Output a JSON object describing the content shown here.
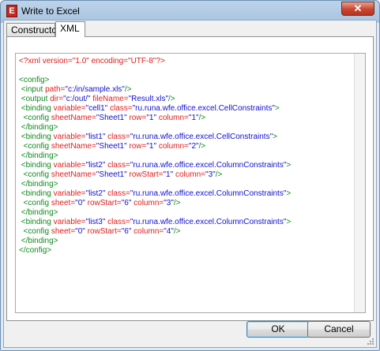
{
  "window": {
    "title": "Write to Excel",
    "icon_glyph": "E",
    "close_glyph": "✕"
  },
  "tabs": [
    {
      "label": "Constructor",
      "active": false
    },
    {
      "label": "XML",
      "active": true
    }
  ],
  "editor": {
    "lines": [
      [
        {
          "t": "decl",
          "s": "<?xml version=\"1.0\" encoding=\"UTF-8\"?>"
        }
      ],
      [],
      [
        {
          "t": "tag",
          "s": "<config>"
        }
      ],
      [
        {
          "t": "tag",
          "s": " <input "
        },
        {
          "t": "attr",
          "s": "path="
        },
        {
          "t": "val",
          "s": "\"c:/in/sample.xls\""
        },
        {
          "t": "tag",
          "s": "/>"
        }
      ],
      [
        {
          "t": "tag",
          "s": " <output "
        },
        {
          "t": "attr",
          "s": "dir="
        },
        {
          "t": "val",
          "s": "\"c:/out/\""
        },
        {
          "t": "attr",
          "s": " fileName="
        },
        {
          "t": "val",
          "s": "\"Result.xls\""
        },
        {
          "t": "tag",
          "s": "/>"
        }
      ],
      [
        {
          "t": "tag",
          "s": " <binding "
        },
        {
          "t": "attr",
          "s": "variable="
        },
        {
          "t": "val",
          "s": "\"cell1\""
        },
        {
          "t": "attr",
          "s": " class="
        },
        {
          "t": "val",
          "s": "\"ru.runa.wfe.office.excel.CellConstraints\""
        },
        {
          "t": "tag",
          "s": ">"
        }
      ],
      [
        {
          "t": "tag",
          "s": "  <config "
        },
        {
          "t": "attr",
          "s": "sheetName="
        },
        {
          "t": "val",
          "s": "\"Sheet1\""
        },
        {
          "t": "attr",
          "s": " row="
        },
        {
          "t": "val",
          "s": "\"1\""
        },
        {
          "t": "attr",
          "s": " column="
        },
        {
          "t": "val",
          "s": "\"1\""
        },
        {
          "t": "tag",
          "s": "/>"
        }
      ],
      [
        {
          "t": "tag",
          "s": " </binding>"
        }
      ],
      [
        {
          "t": "tag",
          "s": " <binding "
        },
        {
          "t": "attr",
          "s": "variable="
        },
        {
          "t": "val",
          "s": "\"list1\""
        },
        {
          "t": "attr",
          "s": " class="
        },
        {
          "t": "val",
          "s": "\"ru.runa.wfe.office.excel.CellConstraints\""
        },
        {
          "t": "tag",
          "s": ">"
        }
      ],
      [
        {
          "t": "tag",
          "s": "  <config "
        },
        {
          "t": "attr",
          "s": "sheetName="
        },
        {
          "t": "val",
          "s": "\"Sheet1\""
        },
        {
          "t": "attr",
          "s": " row="
        },
        {
          "t": "val",
          "s": "\"1\""
        },
        {
          "t": "attr",
          "s": " column="
        },
        {
          "t": "val",
          "s": "\"2\""
        },
        {
          "t": "tag",
          "s": "/>"
        }
      ],
      [
        {
          "t": "tag",
          "s": " </binding>"
        }
      ],
      [
        {
          "t": "tag",
          "s": " <binding "
        },
        {
          "t": "attr",
          "s": "variable="
        },
        {
          "t": "val",
          "s": "\"list2\""
        },
        {
          "t": "attr",
          "s": " class="
        },
        {
          "t": "val",
          "s": "\"ru.runa.wfe.office.excel.ColumnConstraints\""
        },
        {
          "t": "tag",
          "s": ">"
        }
      ],
      [
        {
          "t": "tag",
          "s": "  <config "
        },
        {
          "t": "attr",
          "s": "sheetName="
        },
        {
          "t": "val",
          "s": "\"Sheet1\""
        },
        {
          "t": "attr",
          "s": " rowStart="
        },
        {
          "t": "val",
          "s": "\"1\""
        },
        {
          "t": "attr",
          "s": " column="
        },
        {
          "t": "val",
          "s": "\"3\""
        },
        {
          "t": "tag",
          "s": "/>"
        }
      ],
      [
        {
          "t": "tag",
          "s": " </binding>"
        }
      ],
      [
        {
          "t": "tag",
          "s": " <binding "
        },
        {
          "t": "attr",
          "s": "variable="
        },
        {
          "t": "val",
          "s": "\"list2\""
        },
        {
          "t": "attr",
          "s": " class="
        },
        {
          "t": "val",
          "s": "\"ru.runa.wfe.office.excel.ColumnConstraints\""
        },
        {
          "t": "tag",
          "s": ">"
        }
      ],
      [
        {
          "t": "tag",
          "s": "  <config "
        },
        {
          "t": "attr",
          "s": "sheet="
        },
        {
          "t": "val",
          "s": "\"0\""
        },
        {
          "t": "attr",
          "s": " rowStart="
        },
        {
          "t": "val",
          "s": "\"6\""
        },
        {
          "t": "attr",
          "s": " column="
        },
        {
          "t": "val",
          "s": "\"3\""
        },
        {
          "t": "tag",
          "s": "/>"
        }
      ],
      [
        {
          "t": "tag",
          "s": " </binding>"
        }
      ],
      [
        {
          "t": "tag",
          "s": " <binding "
        },
        {
          "t": "attr",
          "s": "variable="
        },
        {
          "t": "val",
          "s": "\"list3\""
        },
        {
          "t": "attr",
          "s": " class="
        },
        {
          "t": "val",
          "s": "\"ru.runa.wfe.office.excel.ColumnConstraints\""
        },
        {
          "t": "tag",
          "s": ">"
        }
      ],
      [
        {
          "t": "tag",
          "s": "  <config "
        },
        {
          "t": "attr",
          "s": "sheet="
        },
        {
          "t": "val",
          "s": "\"0\""
        },
        {
          "t": "attr",
          "s": " rowStart="
        },
        {
          "t": "val",
          "s": "\"6\""
        },
        {
          "t": "attr",
          "s": " column="
        },
        {
          "t": "val",
          "s": "\"4\""
        },
        {
          "t": "tag",
          "s": "/>"
        }
      ],
      [
        {
          "t": "tag",
          "s": " </binding>"
        }
      ],
      [
        {
          "t": "tag",
          "s": "</config>"
        }
      ]
    ]
  },
  "buttons": {
    "ok_label": "OK",
    "cancel_label": "Cancel"
  },
  "colors": {
    "tag": "#0d8a1a",
    "attr": "#e01c1c",
    "val": "#1010d0",
    "close_button": "#c9452f"
  }
}
